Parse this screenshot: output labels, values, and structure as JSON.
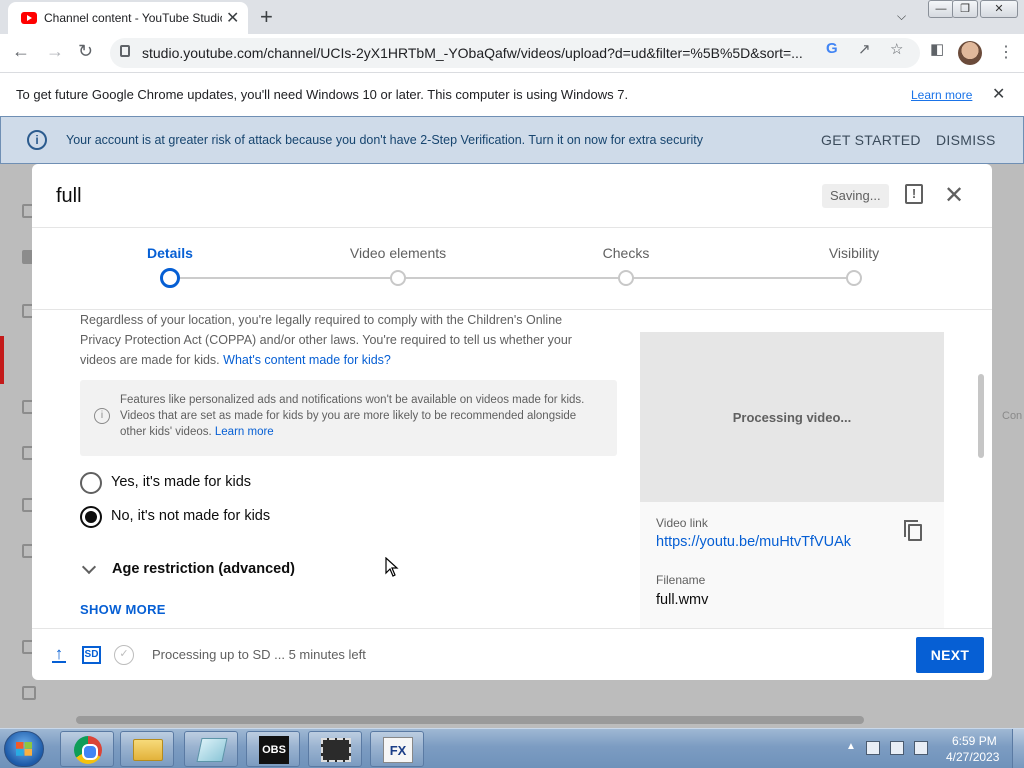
{
  "browser": {
    "tab_title": "Channel content - YouTube Studio",
    "tab_close": "✕",
    "new_tab": "+",
    "url": "studio.youtube.com/channel/UCIs-2yX1HRTbM_-YObaQafw/videos/upload?d=ud&filter=%5B%5D&sort=...",
    "window_controls": [
      "—",
      "❐",
      "✕"
    ]
  },
  "update_bar": {
    "message": "To get future Google Chrome updates, you'll need Windows 10 or later. This computer is using Windows 7.",
    "learn_more": "Learn more",
    "close": "✕"
  },
  "security_bar": {
    "message": "Your account is at greater risk of attack because you don't have 2-Step Verification. Turn it on now for extra security",
    "get_started": "GET STARTED",
    "dismiss": "DISMISS"
  },
  "background": {
    "side_label": "Con"
  },
  "modal": {
    "title": "full",
    "saving": "Saving...",
    "close": "✕",
    "steps": [
      "Details",
      "Video elements",
      "Checks",
      "Visibility"
    ],
    "active_step": 0,
    "coppa_text": "Regardless of your location, you're legally required to comply with the Children's Online Privacy Protection Act (COPPA) and/or other laws. You're required to tell us whether your videos are made for kids.",
    "coppa_link": "What's content made for kids?",
    "notice_text": "Features like personalized ads and notifications won't be available on videos made for kids. Videos that are set as made for kids by you are more likely to be recommended alongside other kids' videos.",
    "notice_link": "Learn more",
    "radio_yes": "Yes, it's made for kids",
    "radio_no": "No, it's not made for kids",
    "selected_radio": "no",
    "age_restriction": "Age restriction (advanced)",
    "show_more": "SHOW MORE",
    "preview_status": "Processing video...",
    "video_link_label": "Video link",
    "video_link": "https://youtu.be/muHtvTfVUAk",
    "filename_label": "Filename",
    "filename": "full.wmv",
    "sd_badge": "SD",
    "footer_status": "Processing up to SD ... 5 minutes left",
    "next": "NEXT"
  },
  "taskbar": {
    "obs_label": "OBS",
    "fx_label": "FX",
    "time": "6:59 PM",
    "date": "4/27/2023"
  }
}
